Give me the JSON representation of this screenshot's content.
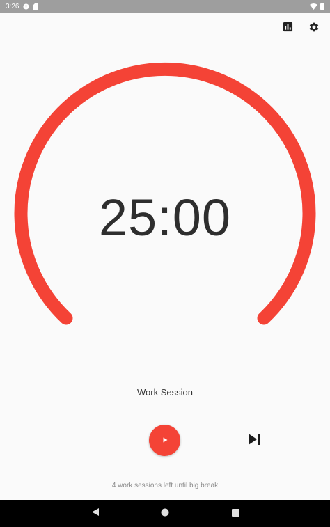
{
  "status_bar": {
    "time": "3:26"
  },
  "timer": {
    "display": "25:00",
    "progress": 1.0,
    "accent_color": "#f44336"
  },
  "session": {
    "label": "Work Session",
    "sessions_left_text": "4 work sessions left until big break"
  },
  "actions": {
    "top_icons": [
      "statistics-icon",
      "settings-icon"
    ],
    "controls": [
      "play-icon",
      "skip-next-icon"
    ]
  },
  "nav": {
    "icons": [
      "back-icon",
      "home-icon",
      "recents-icon"
    ]
  }
}
